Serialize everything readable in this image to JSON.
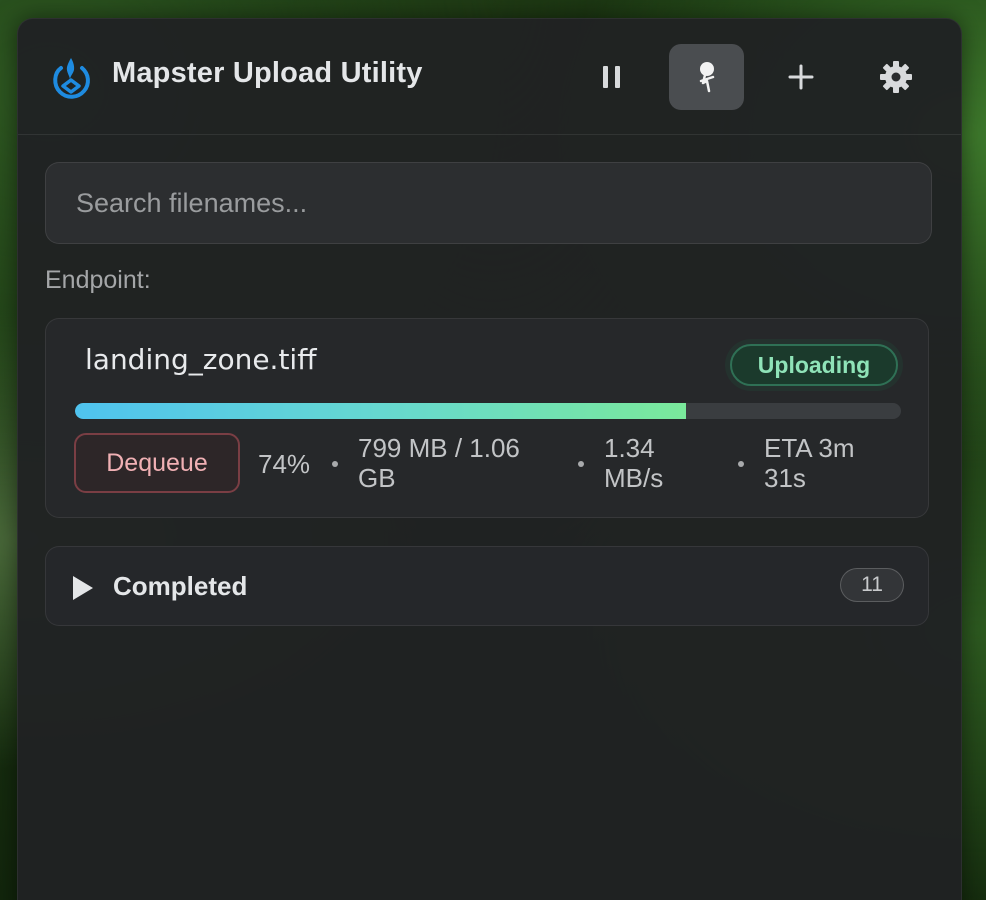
{
  "app": {
    "title": "Mapster Upload Utility"
  },
  "toolbar": {
    "icons": [
      "pause-icon",
      "pin-icon",
      "plus-icon",
      "gear-icon"
    ],
    "pin_active": true
  },
  "search": {
    "placeholder": "Search filenames...",
    "value": ""
  },
  "endpoint": {
    "label": "Endpoint:"
  },
  "upload": {
    "filename": "landing_zone.tiff",
    "status": "Uploading",
    "progress": 0.74,
    "percent": "74%",
    "size_line1": "799 MB / 1.06",
    "size_line2": "GB",
    "speed_line1": "1.34",
    "speed_line2": "MB/s",
    "eta_line1": "ETA 3m",
    "eta_line2": "31s",
    "dequeue_label": "Dequeue"
  },
  "completed": {
    "label": "Completed",
    "count": "11",
    "expanded": false
  },
  "colors": {
    "accent": "#1e8be0",
    "status_green": "#8fe3b8",
    "danger": "#f0b0b4",
    "progress_start": "#4fc3ef",
    "progress_end": "#7ae99b"
  }
}
